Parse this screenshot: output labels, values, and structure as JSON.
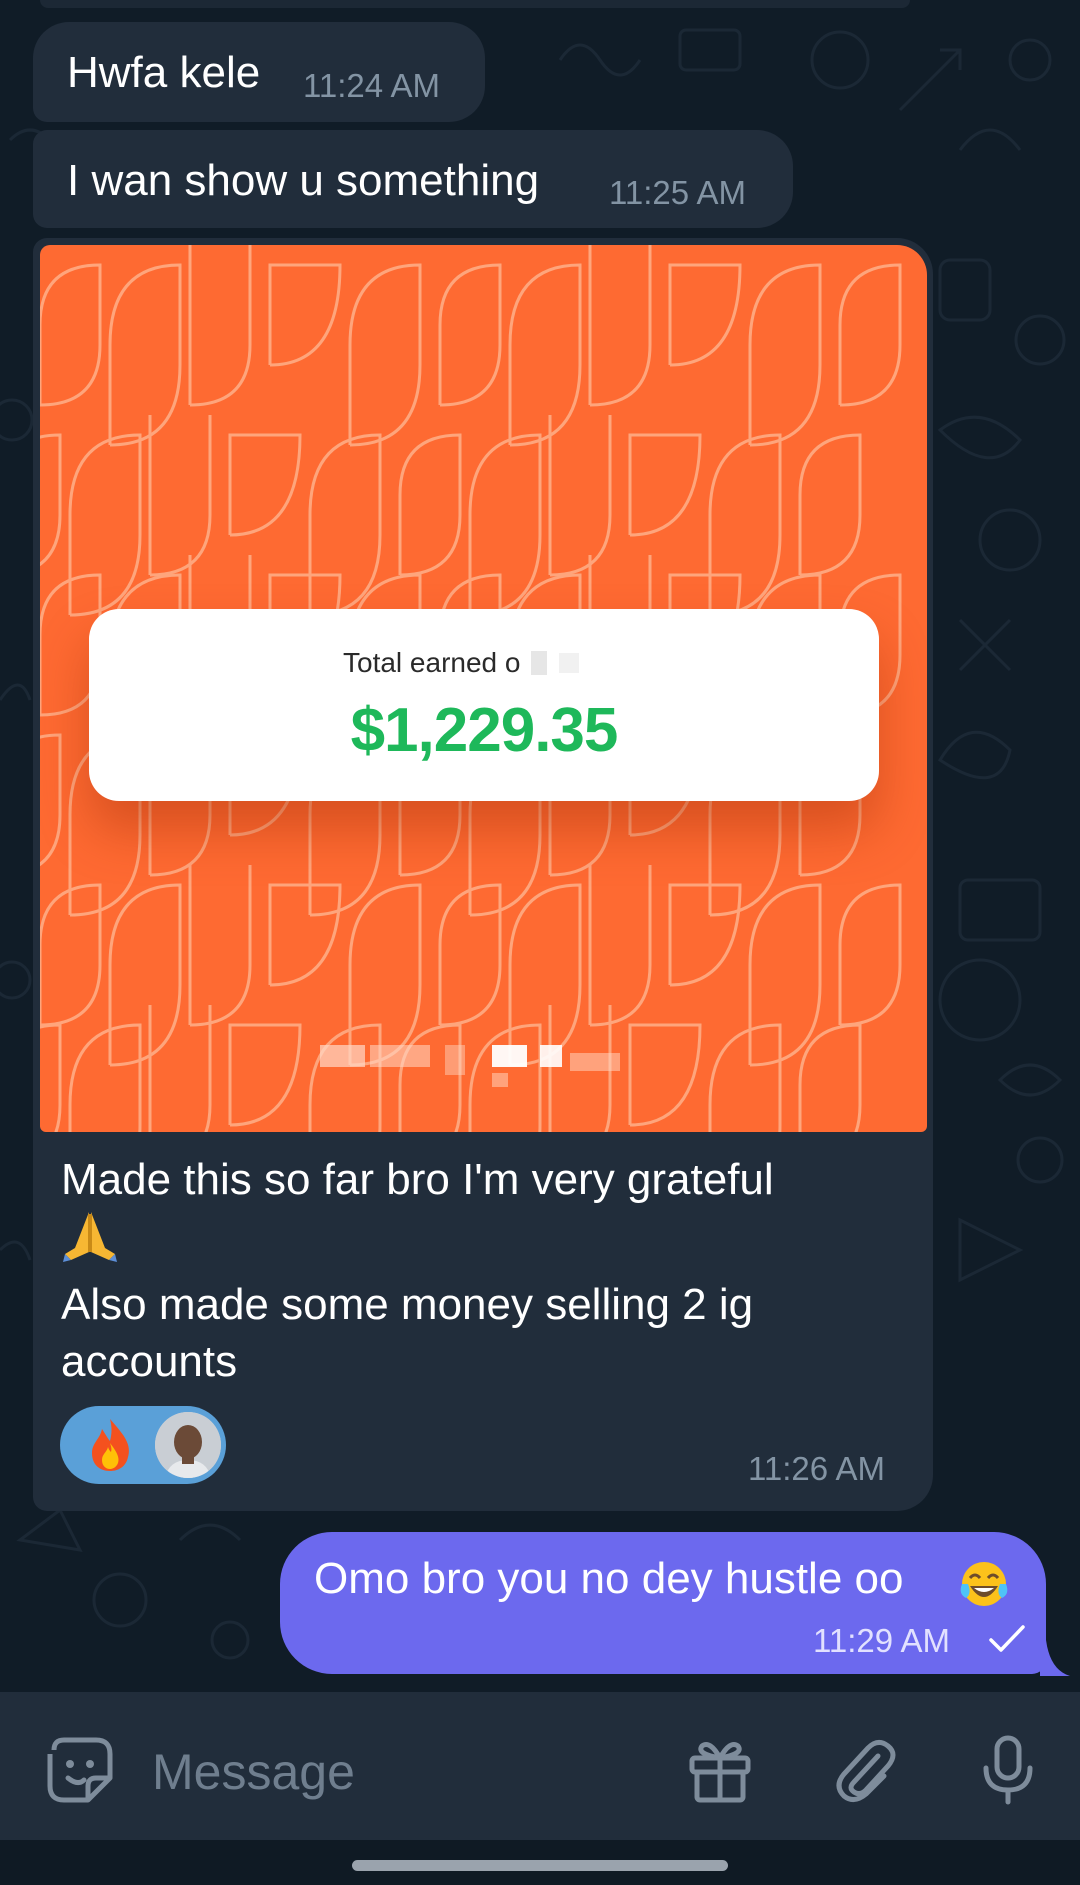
{
  "colors": {
    "background": "#101c27",
    "incoming_bubble": "#212d3b",
    "outgoing_bubble": "#6c69ee",
    "photo_orange": "#fe6a32",
    "amount_green": "#1eb85a",
    "reaction_pill": "#5aa0d8"
  },
  "messages": [
    {
      "text": "Hwfa kele",
      "time": "11:24 AM",
      "direction": "incoming"
    },
    {
      "text": "I wan show u something",
      "time": "11:25 AM",
      "direction": "incoming"
    },
    {
      "direction": "incoming",
      "photo": {
        "card_label": "Total earned o",
        "card_amount": "$1,229.35"
      },
      "caption": {
        "line1": "Made this so far bro I'm very grateful",
        "emoji": "folded-hands-emoji",
        "line2": "Also made some money selling 2 ig",
        "line3": "accounts"
      },
      "reactions": {
        "emoji": "fire-emoji",
        "avatar": "user-avatar"
      },
      "time": "11:26 AM"
    },
    {
      "text": "Omo bro you no dey hustle oo",
      "emoji": "tears-of-joy-emoji",
      "time": "11:29 AM",
      "status": "sent-check-icon",
      "direction": "outgoing"
    }
  ],
  "composer": {
    "placeholder": "Message",
    "icons": [
      "sticker-icon",
      "gift-icon",
      "paperclip-icon",
      "microphone-icon"
    ]
  }
}
